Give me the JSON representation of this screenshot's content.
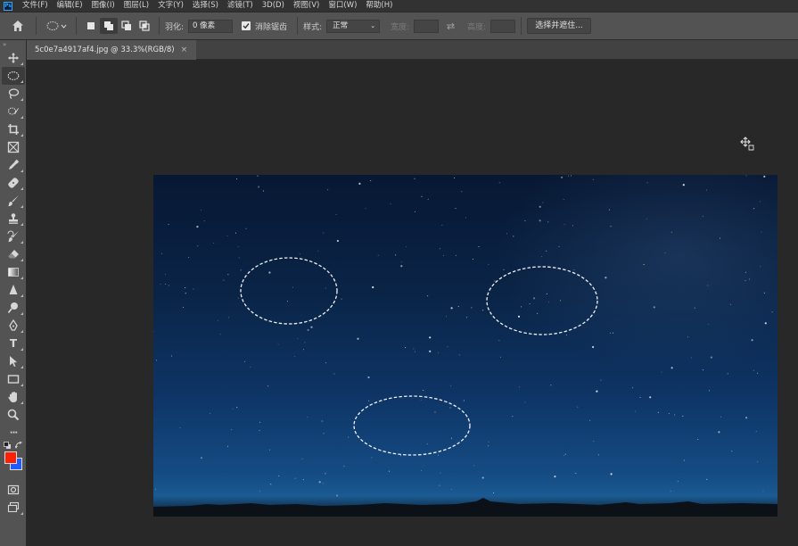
{
  "app": {
    "logo_text": "Ps"
  },
  "menu": [
    "文件(F)",
    "编辑(E)",
    "图像(I)",
    "图层(L)",
    "文字(Y)",
    "选择(S)",
    "滤镜(T)",
    "3D(D)",
    "视图(V)",
    "窗口(W)",
    "帮助(H)"
  ],
  "options": {
    "feather_label": "羽化:",
    "feather_value": "0 像素",
    "antialias_label": "消除锯齿",
    "antialias_checked": true,
    "style_label": "样式:",
    "style_value": "正常",
    "width_label": "宽度:",
    "height_label": "高度:",
    "select_mask_button": "选择并遮住..."
  },
  "document": {
    "tab_title": "5c0e7a4917af4.jpg @ 33.3%(RGB/8)",
    "zoom": "33.3%",
    "color_mode": "RGB/8"
  },
  "colors": {
    "foreground": "#ff2000",
    "background": "#1f5bff"
  },
  "tools": [
    {
      "name": "move-tool-icon"
    },
    {
      "name": "elliptical-marquee-tool-icon",
      "active": true
    },
    {
      "name": "lasso-tool-icon"
    },
    {
      "name": "quick-selection-tool-icon"
    },
    {
      "name": "crop-tool-icon"
    },
    {
      "name": "frame-tool-icon"
    },
    {
      "name": "eyedropper-tool-icon"
    },
    {
      "name": "healing-brush-tool-icon"
    },
    {
      "name": "brush-tool-icon"
    },
    {
      "name": "clone-stamp-tool-icon"
    },
    {
      "name": "history-brush-tool-icon"
    },
    {
      "name": "eraser-tool-icon"
    },
    {
      "name": "gradient-tool-icon"
    },
    {
      "name": "blur-tool-icon"
    },
    {
      "name": "dodge-tool-icon"
    },
    {
      "name": "pen-tool-icon"
    },
    {
      "name": "type-tool-icon"
    },
    {
      "name": "path-selection-tool-icon"
    },
    {
      "name": "rectangle-tool-icon"
    },
    {
      "name": "hand-tool-icon"
    },
    {
      "name": "zoom-tool-icon"
    },
    {
      "name": "edit-toolbar-icon"
    }
  ],
  "type_tool_glyph": "T",
  "more_tools_glyph": "···"
}
